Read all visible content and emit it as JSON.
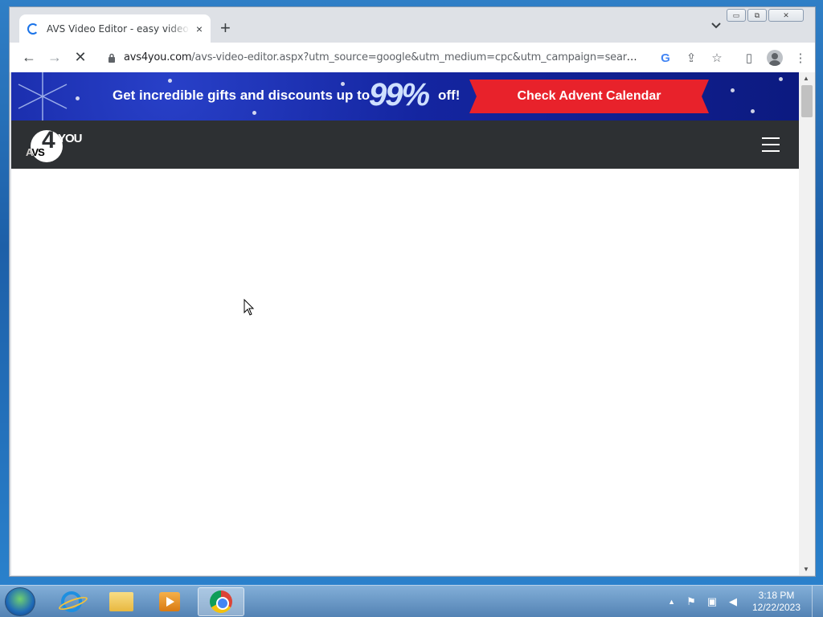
{
  "browser": {
    "tab": {
      "title": "AVS Video Editor - easy video editing",
      "close_icon": "×"
    },
    "new_tab_icon": "+",
    "window_controls": {
      "minimize": "▭",
      "restore": "⧉",
      "close": "✕"
    },
    "nav": {
      "back": "←",
      "forward": "→",
      "reload": "✕"
    },
    "url": {
      "host": "avs4you.com",
      "path": "/avs-video-editor.aspx?utm_source=google&utm_medium=cpc&utm_campaign=search_..."
    },
    "toolbar_icons": {
      "google": "G",
      "share": "⇪",
      "bookmark": "☆",
      "sidepanel": "▯",
      "menu": "⋮"
    }
  },
  "page": {
    "promo": {
      "text": "Get incredible gifts and discounts up to",
      "percent": "99%",
      "off": "off!",
      "button": "Check Advent Calendar"
    },
    "logo": {
      "avs": "AVS",
      "four": "4",
      "you": "YOU"
    }
  },
  "taskbar": {
    "clock_time": "3:18 PM",
    "clock_date": "12/22/2023",
    "tray_arrow": "▲"
  }
}
